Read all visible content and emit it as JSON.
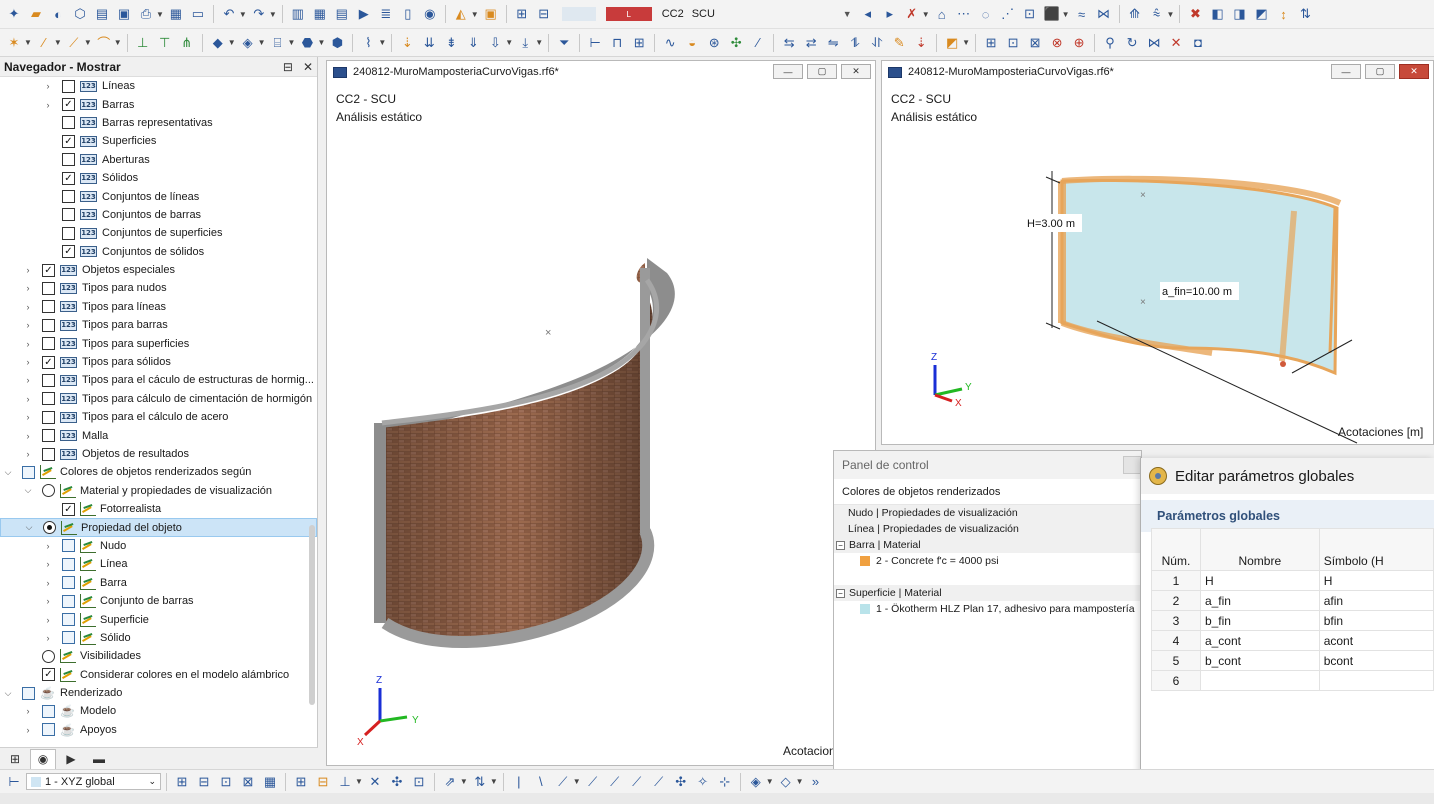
{
  "toolbar_top": {
    "load_case_code": "L",
    "load_case": "CC2",
    "load_case_dropdown": "SCU"
  },
  "navigator": {
    "title": "Navegador - Mostrar",
    "items": [
      {
        "label": "Líneas",
        "level": 2,
        "expander": "›",
        "check": "empty",
        "icon": "123"
      },
      {
        "label": "Barras",
        "level": 2,
        "expander": "›",
        "check": "checked",
        "icon": "123"
      },
      {
        "label": "Barras representativas",
        "level": 2,
        "expander": "",
        "check": "empty",
        "icon": "123"
      },
      {
        "label": "Superficies",
        "level": 2,
        "expander": "",
        "check": "checked",
        "icon": "123"
      },
      {
        "label": "Aberturas",
        "level": 2,
        "expander": "",
        "check": "empty",
        "icon": "123"
      },
      {
        "label": "Sólidos",
        "level": 2,
        "expander": "",
        "check": "checked",
        "icon": "123"
      },
      {
        "label": "Conjuntos de líneas",
        "level": 2,
        "expander": "",
        "check": "empty",
        "icon": "123"
      },
      {
        "label": "Conjuntos de barras",
        "level": 2,
        "expander": "",
        "check": "empty",
        "icon": "123"
      },
      {
        "label": "Conjuntos de superficies",
        "level": 2,
        "expander": "",
        "check": "empty",
        "icon": "123"
      },
      {
        "label": "Conjuntos de sólidos",
        "level": 2,
        "expander": "",
        "check": "checked",
        "icon": "123"
      },
      {
        "label": "Objetos especiales",
        "level": 1,
        "expander": "›",
        "check": "checked",
        "icon": "123"
      },
      {
        "label": "Tipos para nudos",
        "level": 1,
        "expander": "›",
        "check": "empty",
        "icon": "123"
      },
      {
        "label": "Tipos para líneas",
        "level": 1,
        "expander": "›",
        "check": "empty",
        "icon": "123"
      },
      {
        "label": "Tipos para barras",
        "level": 1,
        "expander": "›",
        "check": "empty",
        "icon": "123"
      },
      {
        "label": "Tipos para superficies",
        "level": 1,
        "expander": "›",
        "check": "empty",
        "icon": "123"
      },
      {
        "label": "Tipos para sólidos",
        "level": 1,
        "expander": "›",
        "check": "checked",
        "icon": "123"
      },
      {
        "label": "Tipos para el cáculo de estructuras de hormig...",
        "level": 1,
        "expander": "›",
        "check": "empty",
        "icon": "123"
      },
      {
        "label": "Tipos para cálculo de cimentación de hormigón",
        "level": 1,
        "expander": "›",
        "check": "empty",
        "icon": "123"
      },
      {
        "label": "Tipos para el cálculo de acero",
        "level": 1,
        "expander": "›",
        "check": "empty",
        "icon": "123"
      },
      {
        "label": "Malla",
        "level": 1,
        "expander": "›",
        "check": "empty",
        "icon": "123"
      },
      {
        "label": "Objetos de resultados",
        "level": 1,
        "expander": "›",
        "check": "empty",
        "icon": "123"
      },
      {
        "label": "Colores de objetos renderizados según",
        "level": 0,
        "expander": "⌄",
        "check": "blue",
        "icon": "chart"
      },
      {
        "label": "Material y propiedades de visualización",
        "level": 1,
        "expander": "⌄",
        "check": "radio",
        "icon": "chart"
      },
      {
        "label": "Fotorrealista",
        "level": 2,
        "expander": "",
        "check": "checked",
        "icon": "chart"
      },
      {
        "label": "Propiedad del objeto",
        "level": 1,
        "expander": "⌄",
        "check": "radio-on",
        "icon": "chart",
        "selected": true
      },
      {
        "label": "Nudo",
        "level": 2,
        "expander": "›",
        "check": "blue",
        "icon": "chart"
      },
      {
        "label": "Línea",
        "level": 2,
        "expander": "›",
        "check": "blue",
        "icon": "chart"
      },
      {
        "label": "Barra",
        "level": 2,
        "expander": "›",
        "check": "blue",
        "icon": "chart"
      },
      {
        "label": "Conjunto de barras",
        "level": 2,
        "expander": "›",
        "check": "blue",
        "icon": "chart"
      },
      {
        "label": "Superficie",
        "level": 2,
        "expander": "›",
        "check": "blue",
        "icon": "chart"
      },
      {
        "label": "Sólido",
        "level": 2,
        "expander": "›",
        "check": "blue",
        "icon": "chart"
      },
      {
        "label": "Visibilidades",
        "level": 1,
        "expander": "",
        "check": "radio",
        "icon": "chart"
      },
      {
        "label": "Considerar colores en el modelo alámbrico",
        "level": 1,
        "expander": "",
        "check": "checked",
        "icon": "chart"
      },
      {
        "label": "Renderizado",
        "level": 0,
        "expander": "⌄",
        "check": "blue",
        "icon": "teapot"
      },
      {
        "label": "Modelo",
        "level": 1,
        "expander": "›",
        "check": "blue",
        "icon": "teapot"
      },
      {
        "label": "Apoyos",
        "level": 1,
        "expander": "›",
        "check": "blue",
        "icon": "teapot"
      }
    ]
  },
  "bottom_toolbar": {
    "coordinate_system": "1 - XYZ global"
  },
  "view_left": {
    "title": "240812-MuroMamposteriaCurvoVigas.rf6*",
    "load_case_line": "CC2 - SCU",
    "analysis_line": "Análisis estático",
    "footer": "Acotacion"
  },
  "view_right": {
    "title": "240812-MuroMamposteriaCurvoVigas.rf6*",
    "load_case_line": "CC2 - SCU",
    "analysis_line": "Análisis estático",
    "dimension_h": "H=3.00 m",
    "dimension_afin": "a_fin=10.00 m",
    "footer": "Acotaciones [m]"
  },
  "axes_labels": {
    "z": "Z",
    "y": "Y",
    "x": "X"
  },
  "control_panel": {
    "title": "Panel de control",
    "subtitle": "Colores de objetos renderizados",
    "rows": [
      {
        "label": "Nudo | Propiedades de visualización",
        "kind": "group"
      },
      {
        "label": "Línea | Propiedades de visualización",
        "kind": "group"
      },
      {
        "label": "Barra | Material",
        "kind": "group-exp"
      },
      {
        "label": "2 - Concrete f'c = 4000 psi",
        "kind": "item",
        "color": "#f0a040"
      },
      {
        "label": "",
        "kind": "spacer"
      },
      {
        "label": "Superficie | Material",
        "kind": "group-exp"
      },
      {
        "label": "1 - Ökotherm HLZ Plan 17, adhesivo para mampostería",
        "kind": "item",
        "color": "#b9e3ea"
      }
    ]
  },
  "global_params": {
    "title": "Editar parámetros globales",
    "section": "Parámetros globales",
    "col_num": "Núm.",
    "col_name": "Nombre",
    "col_symbol": "Símbolo (H",
    "rows": [
      {
        "num": "1",
        "name": "H",
        "symbol": "H"
      },
      {
        "num": "2",
        "name": "a_fin",
        "symbol": "afin"
      },
      {
        "num": "3",
        "name": "b_fin",
        "symbol": "bfin"
      },
      {
        "num": "4",
        "name": "a_cont",
        "symbol": "acont"
      },
      {
        "num": "5",
        "name": "b_cont",
        "symbol": "bcont"
      },
      {
        "num": "6",
        "name": "",
        "symbol": ""
      }
    ]
  }
}
